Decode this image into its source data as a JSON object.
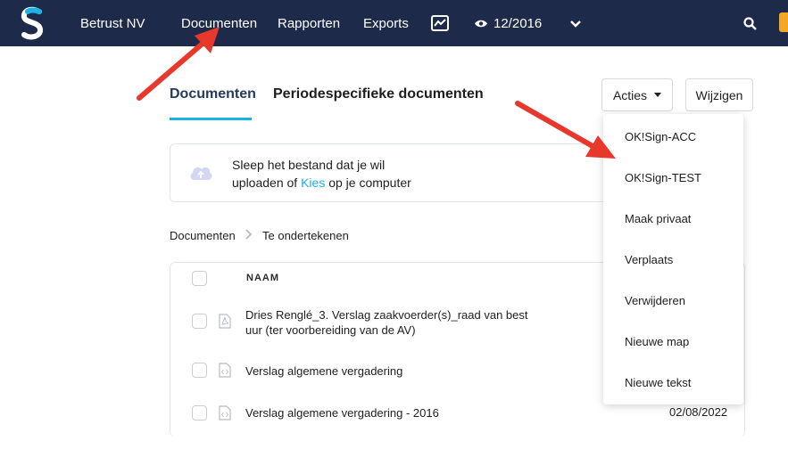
{
  "navbar": {
    "company": "Betrust NV",
    "documents": "Documenten",
    "reports": "Rapporten",
    "exports": "Exports",
    "period": "12/2016",
    "colors": {
      "background": "#1e2a4a",
      "accent": "#1ab3e6"
    }
  },
  "tabs": {
    "active": "Documenten",
    "other": "Periodespecifieke documenten"
  },
  "buttons": {
    "actions": "Acties",
    "edit": "Wijzigen"
  },
  "upload": {
    "line1": "Sleep het bestand dat je wil",
    "line2_prefix": "uploaden of ",
    "line2_link": "Kies",
    "line2_suffix": " op je computer"
  },
  "breadcrumb": {
    "root": "Documenten",
    "current": "Te ondertekenen"
  },
  "table": {
    "column_name": "NAAM",
    "rows": [
      {
        "name_line1": "Dries Renglé_3. Verslag zaakvoerder(s)_raad van best",
        "name_line2": "uur (ter voorbereiding van de AV)",
        "icon": "pdf-file-icon"
      },
      {
        "name_line1": "Verslag algemene vergadering",
        "icon": "code-file-icon"
      },
      {
        "name_line1": "Verslag algemene vergadering - 2016",
        "date": "02/08/2022",
        "icon": "code-file-icon"
      }
    ]
  },
  "dropdown": {
    "items": [
      "OK!Sign-ACC",
      "OK!Sign-TEST",
      "Maak privaat",
      "Verplaats",
      "Verwijderen",
      "Nieuwe map",
      "Nieuwe tekst"
    ]
  },
  "annotation_color": "#e8382b"
}
